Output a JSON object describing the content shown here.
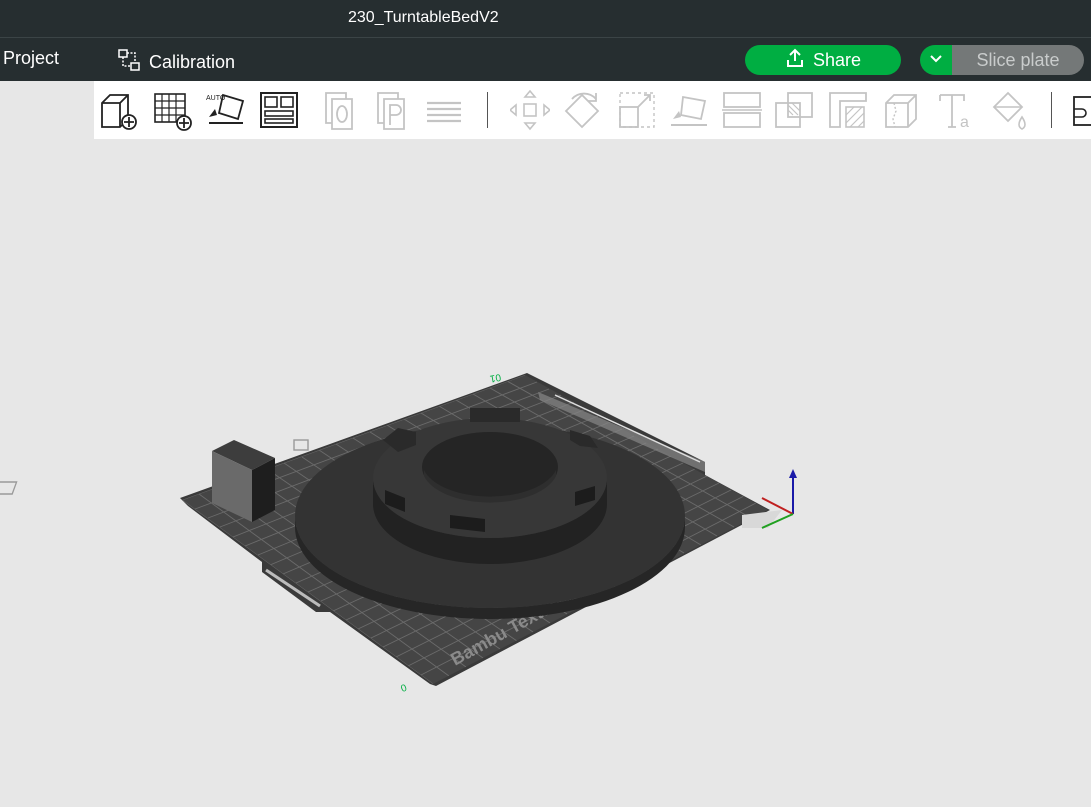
{
  "window": {
    "title": "230_TurntableBedV2"
  },
  "menubar": {
    "project_label": "Project",
    "calibration_label": "Calibration",
    "share_label": "Share",
    "slice_label": "Slice plate"
  },
  "toolbar": {
    "tools": [
      {
        "name": "add-object-icon",
        "enabled": true
      },
      {
        "name": "add-plate-icon",
        "enabled": true
      },
      {
        "name": "auto-orient-icon",
        "enabled": true
      },
      {
        "name": "arrange-icon",
        "enabled": true
      },
      {
        "name": "split-objects-icon",
        "enabled": false
      },
      {
        "name": "split-parts-icon",
        "enabled": false
      },
      {
        "name": "layers-icon",
        "enabled": false
      },
      {
        "name": "move-icon",
        "enabled": false
      },
      {
        "name": "rotate-icon",
        "enabled": false
      },
      {
        "name": "scale-icon",
        "enabled": false
      },
      {
        "name": "lay-on-face-icon",
        "enabled": false
      },
      {
        "name": "cut-icon",
        "enabled": false
      },
      {
        "name": "boolean-icon",
        "enabled": false
      },
      {
        "name": "support-paint-icon",
        "enabled": false
      },
      {
        "name": "seam-paint-icon",
        "enabled": false
      },
      {
        "name": "text-icon",
        "enabled": false
      },
      {
        "name": "color-paint-icon",
        "enabled": false
      },
      {
        "name": "assembly-icon",
        "enabled": false
      }
    ]
  },
  "viewport": {
    "plate_label": "Bambu Textured PEI Plate",
    "accent": "#00ae42"
  }
}
